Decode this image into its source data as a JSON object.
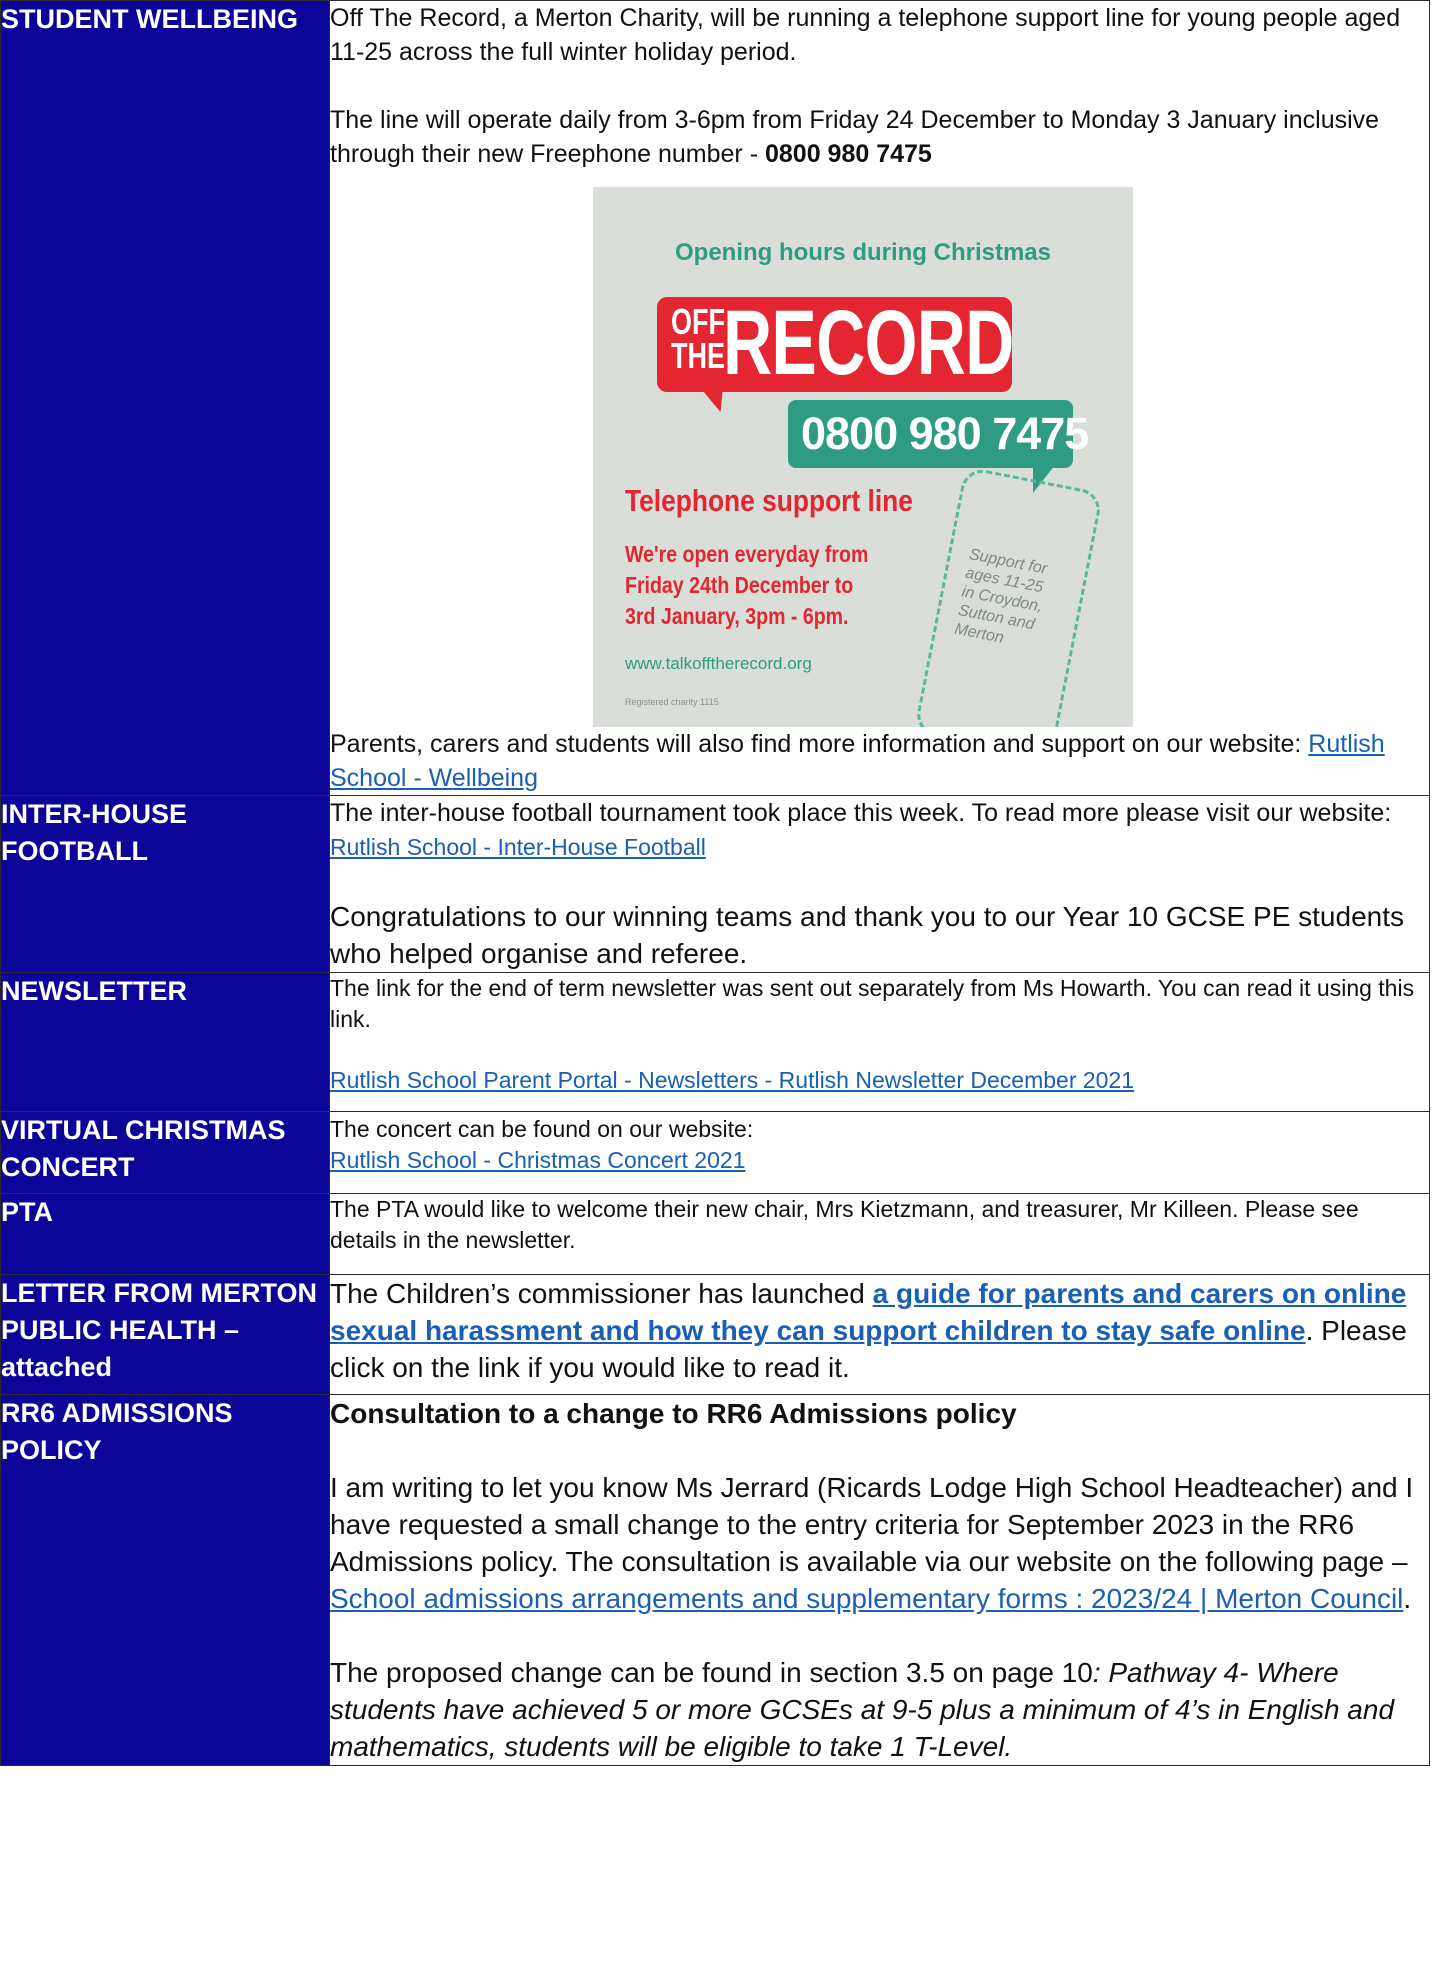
{
  "sections": {
    "wellbeing": {
      "heading": "STUDENT WELLBEING",
      "p1": "Off The Record, a Merton Charity, will be running a telephone support line for young people aged 11-25 across the full winter holiday period.",
      "p2_text": "The line will operate daily from 3-6pm from Friday 24 December to Monday 3 January inclusive through their new Freephone number - ",
      "p2_bold": "0800 980 7475",
      "poster": {
        "title": "Opening hours during Christmas",
        "logo_small": "OFF THE",
        "logo_big": "RECORD",
        "phone": "0800 980 7475",
        "subtitle": "Telephone support line",
        "open_l1": "We're open everyday from",
        "open_l2": "Friday 24th December to",
        "open_l3": "3rd January, 3pm - 6pm.",
        "url": "www.talkofftherecord.org",
        "fine_print": "Registered charity 1115",
        "phone_text": "Support for ages 11-25 in Croydon, Sutton and Merton",
        "colors": {
          "red": "#e32631",
          "green": "#2e9b82",
          "background": "#d9ded8"
        }
      },
      "p3_text": "Parents, carers and students will also find more information and support on our website: ",
      "p3_link": "Rutlish School - Wellbeing"
    },
    "football": {
      "heading": "INTER-HOUSE FOOTBALL",
      "p1_text": "The inter-house football tournament took place this week.  To read more please visit our website: ",
      "p1_link": "Rutlish School - Inter-House Football",
      "p2": "Congratulations to our winning teams and thank you to our Year 10 GCSE PE students who helped organise and referee."
    },
    "newsletter": {
      "heading": "NEWSLETTER",
      "p1": "The link for the end of term newsletter was sent out separately from Ms Howarth. You can read it using this link.",
      "link": "Rutlish School Parent Portal - Newsletters - Rutlish Newsletter December 2021"
    },
    "concert": {
      "heading": "VIRTUAL CHRISTMAS CONCERT",
      "p1": "The concert can be found on our website:",
      "link": "Rutlish School - Christmas Concert 2021"
    },
    "pta": {
      "heading": "PTA",
      "p1": "The PTA would like to welcome their new chair, Mrs Kietzmann, and treasurer, Mr Killeen. Please see details in the newsletter."
    },
    "merton_letter": {
      "heading": "LETTER FROM MERTON PUBLIC HEALTH – attached",
      "p1_text": "The Children’s commissioner has launched ",
      "p1_link": "a guide for parents and carers on online sexual harassment and how they can support children to stay safe online",
      "p1_tail": ". Please click on the link if you would like to read it."
    },
    "rr6": {
      "heading": "RR6 ADMISSIONS POLICY",
      "title": "Consultation to a change to RR6 Admissions policy",
      "p1_text": "I am writing to let you know Ms Jerrard (Ricards Lodge High School Headteacher) and I have requested a small change to the entry criteria for September 2023 in the RR6 Admissions policy.  The consultation is available via our website on the following page – ",
      "p1_link": "School admissions arrangements and supplementary forms : 2023/24 | Merton Council",
      "p1_tail": ".",
      "p2_text": "The proposed change can be found in section 3.5 on page 10",
      "p2_italic": ":  Pathway 4- Where students have achieved 5 or more GCSEs at 9-5 plus a minimum of 4’s in English and mathematics, students will be eligible to take 1 T-Level."
    }
  },
  "colors": {
    "heading_bg": "#0b0598",
    "link": "#1a5fb4"
  }
}
